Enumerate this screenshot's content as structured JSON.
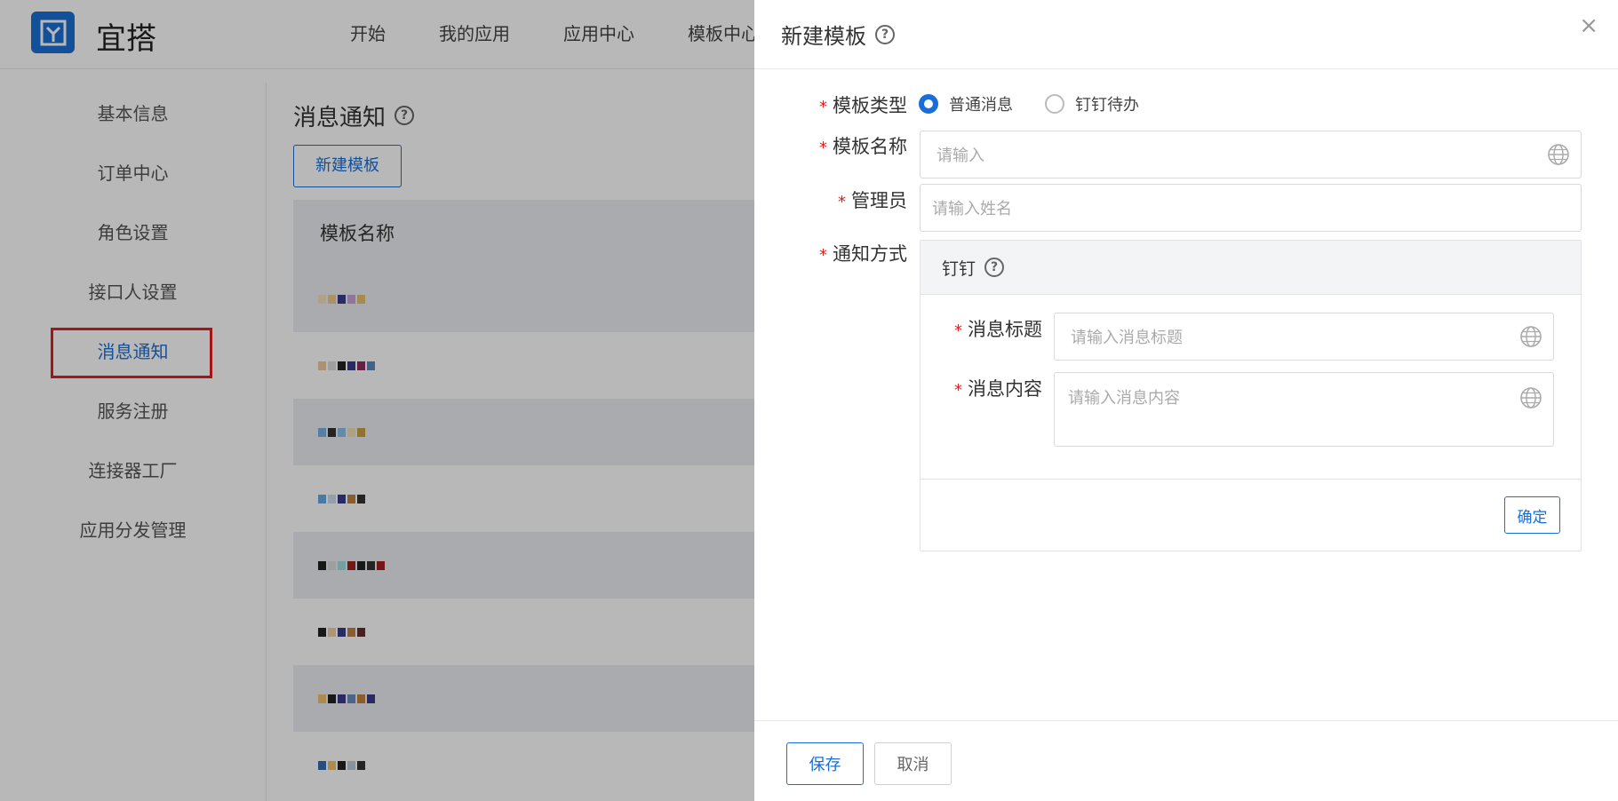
{
  "app": {
    "brand": "宜搭",
    "nav": [
      "开始",
      "我的应用",
      "应用中心",
      "模板中心"
    ]
  },
  "sidebar": {
    "items": [
      "基本信息",
      "订单中心",
      "角色设置",
      "接口人设置",
      "消息通知",
      "服务注册",
      "连接器工厂",
      "应用分发管理"
    ],
    "active": "消息通知"
  },
  "main": {
    "title": "消息通知",
    "new_button": "新建模板",
    "table_header": "模板名称"
  },
  "drawer": {
    "title": "新建模板",
    "close_label": "×",
    "type_label": "模板类型",
    "type_options": [
      "普通消息",
      "钉钉待办"
    ],
    "type_selected": "普通消息",
    "name_label": "模板名称",
    "name_placeholder": "请输入",
    "admin_label": "管理员",
    "admin_placeholder": "请输入姓名",
    "notify_label": "通知方式",
    "notify_panel": {
      "title": "钉钉",
      "msg_title_label": "消息标题",
      "msg_title_placeholder": "请输入消息标题",
      "msg_content_label": "消息内容",
      "msg_content_placeholder": "请输入消息内容",
      "confirm": "确定"
    },
    "save": "保存",
    "cancel": "取消"
  },
  "colors": {
    "accent": "#1a6fd6",
    "required": "#e02020"
  }
}
